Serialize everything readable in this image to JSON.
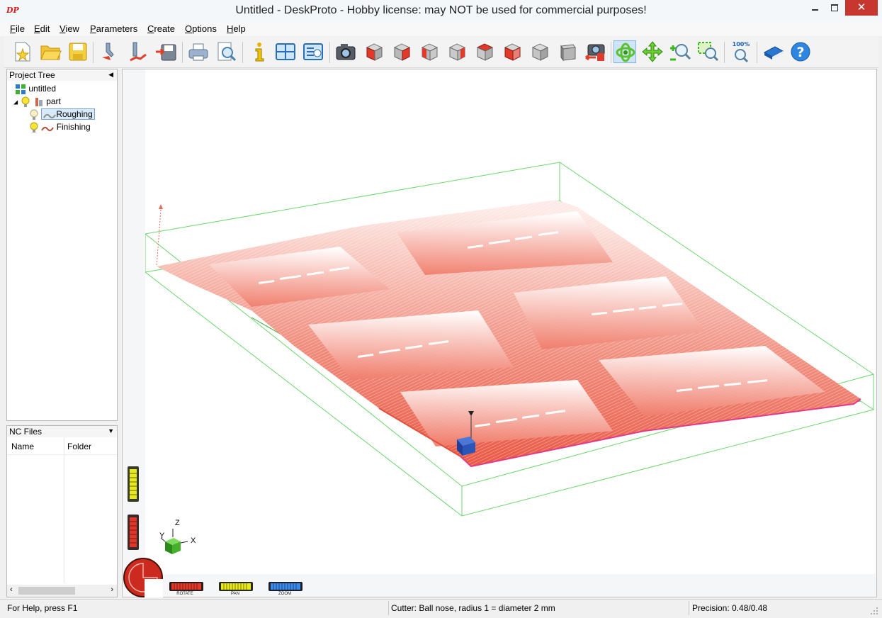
{
  "window": {
    "logo": "DP",
    "title": "Untitled - DeskProto - Hobby license: may NOT be used for commercial purposes!"
  },
  "menu": [
    {
      "label": "File",
      "ul": "F",
      "rest": "ile"
    },
    {
      "label": "Edit",
      "ul": "E",
      "rest": "dit"
    },
    {
      "label": "View",
      "ul": "V",
      "rest": "iew"
    },
    {
      "label": "Parameters",
      "ul": "P",
      "rest": "arameters"
    },
    {
      "label": "Create",
      "ul": "C",
      "rest": "reate"
    },
    {
      "label": "Options",
      "ul": "O",
      "rest": "ptions"
    },
    {
      "label": "Help",
      "ul": "H",
      "rest": "elp"
    }
  ],
  "toolbar": [
    {
      "icon": "new-project-icon"
    },
    {
      "icon": "open-folder-icon"
    },
    {
      "icon": "save-icon"
    },
    {
      "icon": "import-geometry-icon"
    },
    {
      "icon": "add-toolpath-icon"
    },
    {
      "icon": "save-nc-icon"
    },
    {
      "icon": "print-icon"
    },
    {
      "icon": "print-preview-icon"
    },
    {
      "icon": "info-icon"
    },
    {
      "icon": "split-view-icon"
    },
    {
      "icon": "view-list-icon"
    },
    {
      "icon": "camera-icon"
    },
    {
      "icon": "view-front-icon"
    },
    {
      "icon": "view-back-icon"
    },
    {
      "icon": "view-left-icon"
    },
    {
      "icon": "view-right-icon"
    },
    {
      "icon": "view-top-icon"
    },
    {
      "icon": "view-bottom-icon"
    },
    {
      "icon": "view-iso-icon"
    },
    {
      "icon": "view-shaded-icon"
    },
    {
      "icon": "camera-reset-icon"
    },
    {
      "icon": "rotate-icon",
      "active": true
    },
    {
      "icon": "pan-icon"
    },
    {
      "icon": "zoom-icon"
    },
    {
      "icon": "zoom-window-icon"
    },
    {
      "icon": "zoom-100-icon",
      "text": "100%"
    },
    {
      "icon": "manual-book-icon"
    },
    {
      "icon": "help-icon",
      "text": "?"
    }
  ],
  "project_tree": {
    "title": "Project Tree",
    "items": [
      {
        "label": "untitled",
        "level": 0
      },
      {
        "label": "part",
        "level": 1
      },
      {
        "label": "Roughing",
        "level": 2,
        "selected": true
      },
      {
        "label": "Finishing",
        "level": 2
      }
    ]
  },
  "nc_files": {
    "title": "NC Files",
    "columns": [
      "Name",
      "Folder"
    ]
  },
  "axes": {
    "z": "Z",
    "y": "Y",
    "x": "X"
  },
  "modes": {
    "rotate": "ROTATE",
    "pan": "PAN",
    "zoom": "ZOOM"
  },
  "status": {
    "help": "For Help, press F1",
    "cutter": "Cutter: Ball nose, radius 1 = diameter 2 mm",
    "precision": "Precision: 0.48/0.48"
  },
  "colors": {
    "toolpath": "#ec6a5a",
    "bounding_box": "#6cd66c",
    "accent": "#2a7fd4"
  }
}
